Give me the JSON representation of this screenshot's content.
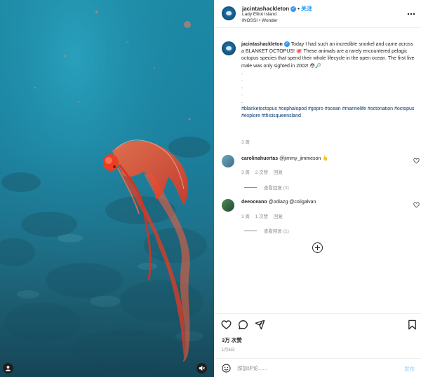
{
  "post": {
    "username": "jacintashackleton",
    "verified_mark": "✓",
    "separator": "•",
    "follow_label": "关注",
    "location": "Lady Elliot Island",
    "audio": "INOSSI • Wonder",
    "more_icon": "more-horizontal-icon"
  },
  "caption": {
    "username": "jacintashackleton",
    "text": "Today I had such an incredible snorkel and came across a BLANKET OCTOPUS! 🐙 These animals are a rarely encountered pelagic octopus species that spend their whole lifecycle in the open ocean. The first live male was only sighted in 2002! 😳🔎",
    "dots": [
      ".",
      ".",
      ".",
      ".",
      "."
    ],
    "hashtags": [
      "#blanketoctopus",
      "#cephalopod",
      "#gopro",
      "#ocean",
      "#marinelife",
      "#octonation",
      "#octopus",
      "#explore",
      "#thisisqueensland"
    ],
    "time": "3 周"
  },
  "comments": [
    {
      "username": "carolinahuertas",
      "text": "@jimmy_jimmeson 👆",
      "time": "3 周",
      "likes": "2 次赞",
      "reply": "回复",
      "view_replies": "查看回复 (2)"
    },
    {
      "username": "deeoceano",
      "text": "@odiazg @coligalvan",
      "time": "3 周",
      "likes": "1 次赞",
      "reply": "回复",
      "view_replies": "查看回复 (1)"
    }
  ],
  "actions": {
    "like_icon": "heart-icon",
    "comment_icon": "comment-icon",
    "share_icon": "share-icon",
    "save_icon": "bookmark-icon",
    "likes_count": "3万 次赞",
    "date": "1月6日"
  },
  "add_comment": {
    "placeholder": "添加评论......",
    "post_label": "发布"
  },
  "colors": {
    "link_blue": "#0095f6",
    "hashtag": "#00376b",
    "muted": "#8e8e8e",
    "octopus": "#e8412a"
  }
}
